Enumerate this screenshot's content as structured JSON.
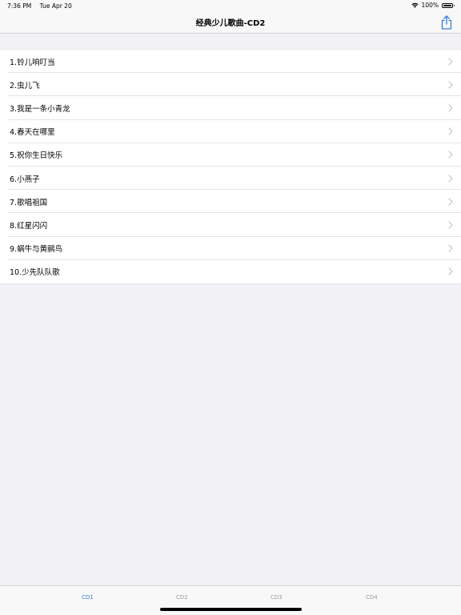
{
  "status_bar": {
    "time": "7:36 PM",
    "date": "Tue Apr 20",
    "battery": "100%",
    "battery_level": 1.0
  },
  "nav": {
    "title": "经典少儿歌曲-CD2",
    "share_icon": "share-icon"
  },
  "songs": [
    "1.铃儿响叮当",
    "2.虫儿飞",
    "3.我是一条小青龙",
    "4.春天在哪里",
    "5.祝你生日快乐",
    "6.小燕子",
    "7.歌唱祖国",
    "8.红星闪闪",
    "9.蜗牛与黄鹂鸟",
    "10.少先队队歌"
  ],
  "tabs": [
    {
      "label": "CD1",
      "active": true
    },
    {
      "label": "CD2",
      "active": false
    },
    {
      "label": "CD3",
      "active": false
    },
    {
      "label": "CD4",
      "active": false
    }
  ],
  "colors": {
    "accent": "#3a7bd5",
    "inactive_tab": "#9a9a9e",
    "background": "#f2f2f6"
  }
}
